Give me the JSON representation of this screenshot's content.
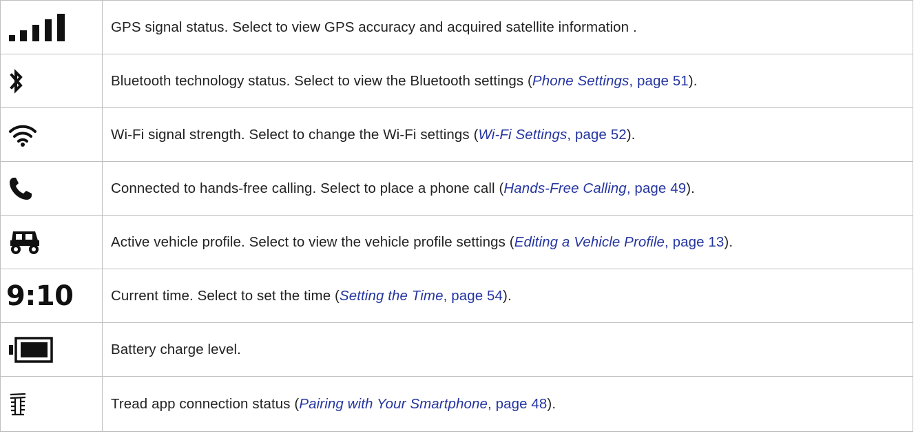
{
  "rows": [
    {
      "icon": "gps-signal-icon",
      "text": "GPS signal status. Select to view GPS accuracy and acquired satellite information ."
    },
    {
      "icon": "bluetooth-icon",
      "text": "Bluetooth technology status. Select to view the Bluetooth settings (",
      "link_title": "Phone Settings",
      "link_page": ", page 51",
      "text_end": ")."
    },
    {
      "icon": "wifi-icon",
      "text": "Wi-Fi signal strength. Select to change the Wi-Fi settings (",
      "link_title": "Wi-Fi Settings",
      "link_page": ", page 52",
      "text_end": ")."
    },
    {
      "icon": "phone-icon",
      "text": "Connected to hands-free calling. Select to place a phone call (",
      "link_title": "Hands-Free Calling",
      "link_page": ", page 49",
      "text_end": ")."
    },
    {
      "icon": "vehicle-icon",
      "text": "Active vehicle profile. Select to view the vehicle profile settings (",
      "link_title": "Editing a Vehicle Profile",
      "link_page": ", page 13",
      "text_end": ")."
    },
    {
      "icon": "time-icon",
      "icon_text": "9:10",
      "text": "Current time. Select to set the time (",
      "link_title": "Setting the Time",
      "link_page": ", page 54",
      "text_end": ")."
    },
    {
      "icon": "battery-icon",
      "text": "Battery charge level."
    },
    {
      "icon": "tread-app-icon",
      "text": "Tread app connection status (",
      "link_title": "Pairing with Your Smartphone",
      "link_page": ", page 48",
      "text_end": ")."
    }
  ]
}
